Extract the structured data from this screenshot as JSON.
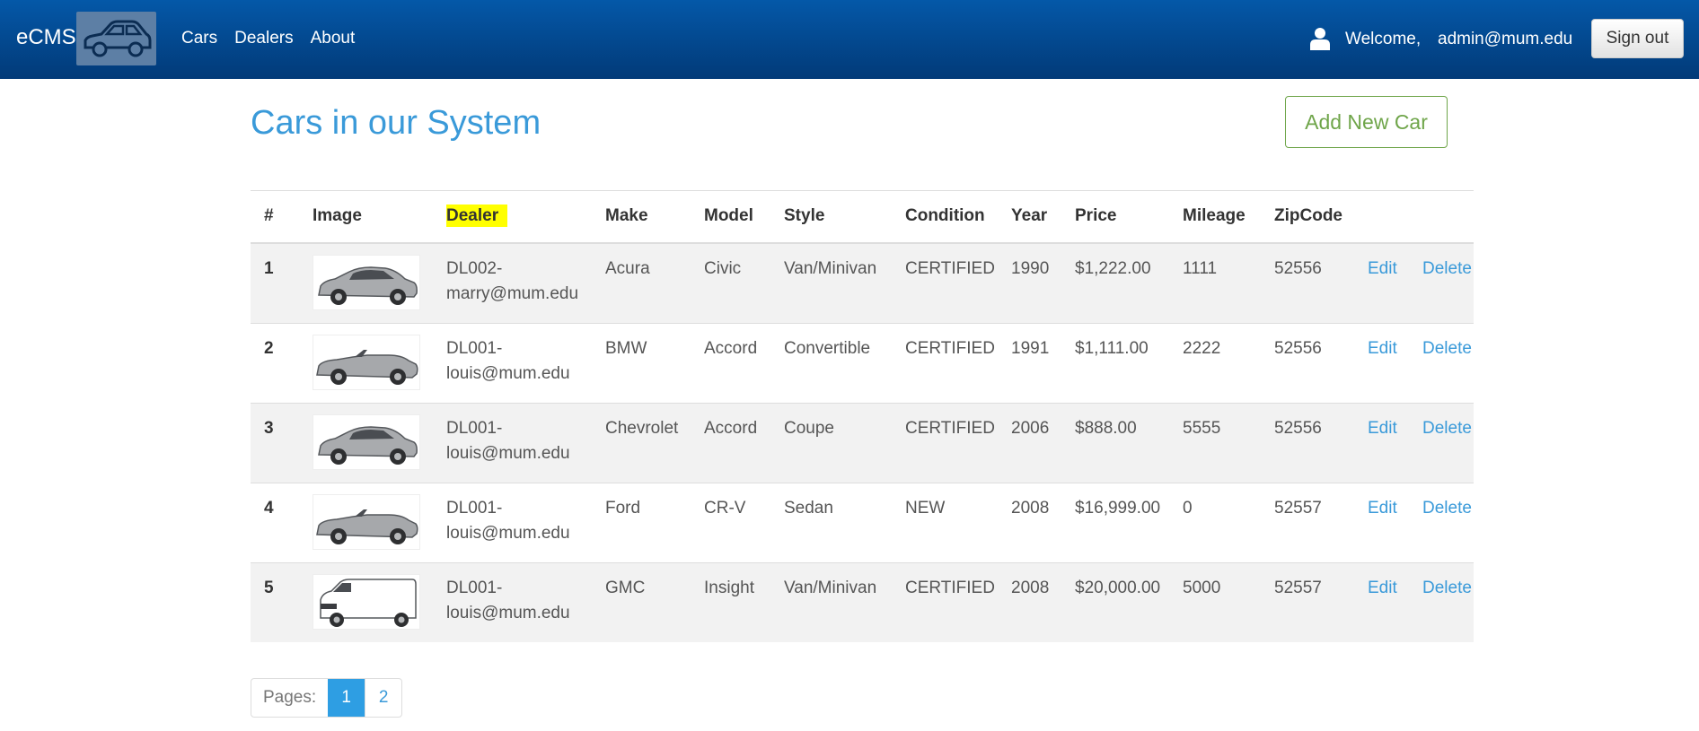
{
  "nav": {
    "brand": "eCMS",
    "links": [
      "Cars",
      "Dealers",
      "About"
    ],
    "welcome": "Welcome,",
    "email": "admin@mum.edu",
    "signout": "Sign out"
  },
  "page": {
    "title": "Cars in our System",
    "add_button": "Add New Car"
  },
  "table": {
    "headers": [
      "#",
      "Image",
      "Dealer",
      "Make",
      "Model",
      "Style",
      "Condition",
      "Year",
      "Price",
      "Mileage",
      "ZipCode"
    ],
    "rows": [
      {
        "num": "1",
        "dealer_line1": "DL002-",
        "dealer_line2": "marry@mum.edu",
        "make": "Acura",
        "model": "Civic",
        "style": "Van/Minivan",
        "condition": "CERTIFIED",
        "year": "1990",
        "price": "$1,222.00",
        "mileage": "1111",
        "zip": "52556",
        "image": "sedan-image"
      },
      {
        "num": "2",
        "dealer_line1": "DL001-",
        "dealer_line2": "louis@mum.edu",
        "make": "BMW",
        "model": "Accord",
        "style": "Convertible",
        "condition": "CERTIFIED",
        "year": "1991",
        "price": "$1,111.00",
        "mileage": "2222",
        "zip": "52556",
        "image": "convertible-image"
      },
      {
        "num": "3",
        "dealer_line1": "DL001-",
        "dealer_line2": "louis@mum.edu",
        "make": "Chevrolet",
        "model": "Accord",
        "style": "Coupe",
        "condition": "CERTIFIED",
        "year": "2006",
        "price": "$888.00",
        "mileage": "5555",
        "zip": "52556",
        "image": "sedan-image"
      },
      {
        "num": "4",
        "dealer_line1": "DL001-",
        "dealer_line2": "louis@mum.edu",
        "make": "Ford",
        "model": "CR-V",
        "style": "Sedan",
        "condition": "NEW",
        "year": "2008",
        "price": "$16,999.00",
        "mileage": "0",
        "zip": "52557",
        "image": "convertible-image"
      },
      {
        "num": "5",
        "dealer_line1": "DL001-",
        "dealer_line2": "louis@mum.edu",
        "make": "GMC",
        "model": "Insight",
        "style": "Van/Minivan",
        "condition": "CERTIFIED",
        "year": "2008",
        "price": "$20,000.00",
        "mileage": "5000",
        "zip": "52557",
        "image": "van-image"
      }
    ],
    "edit_label": "Edit",
    "delete_label": "Delete"
  },
  "pagination": {
    "label": "Pages:",
    "pages": [
      "1",
      "2"
    ],
    "active": "1"
  },
  "colors": {
    "navbar_top": "#0458a8",
    "navbar_bottom": "#023a78",
    "title": "#3a9ad9",
    "add_button": "#6fa54a",
    "highlight": "#ffff00",
    "link": "#3a9ad9",
    "active_page": "#2e9ee3"
  }
}
